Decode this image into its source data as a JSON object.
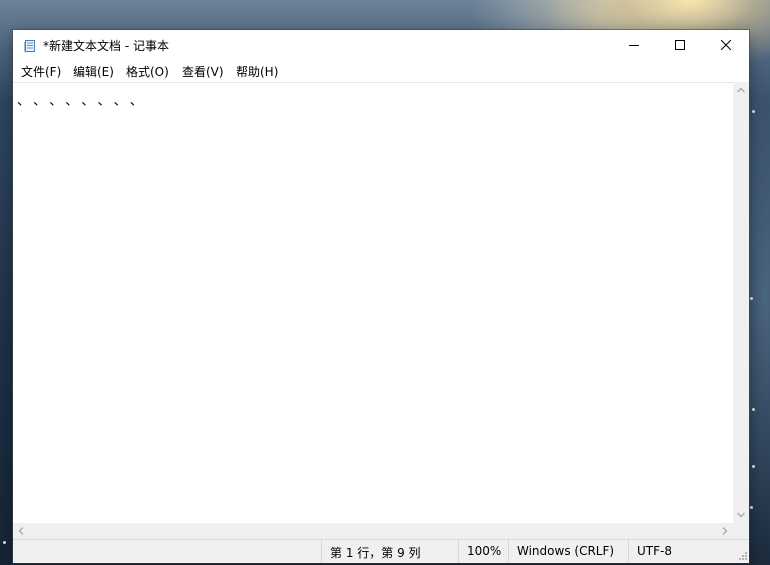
{
  "window": {
    "title": "*新建文本文档 - 记事本",
    "app_icon": "notepad-icon"
  },
  "titlebar_buttons": {
    "minimize_icon": "minimize-icon",
    "maximize_icon": "maximize-icon",
    "close_icon": "close-icon"
  },
  "menu": {
    "items": [
      {
        "label": "文件(F)"
      },
      {
        "label": "编辑(E)"
      },
      {
        "label": "格式(O)"
      },
      {
        "label": "查看(V)"
      },
      {
        "label": "帮助(H)"
      }
    ]
  },
  "editor": {
    "content": "、、、、、、、、"
  },
  "scrollbars": {
    "up_icon": "chevron-up-icon",
    "down_icon": "chevron-down-icon",
    "left_icon": "chevron-left-icon",
    "right_icon": "chevron-right-icon"
  },
  "status": {
    "position": "第 1 行，第 9 列",
    "zoom": "100%",
    "line_ending": "Windows (CRLF)",
    "encoding": "UTF-8"
  },
  "colors": {
    "window_bg": "#ffffff",
    "status_bg": "#f0f0f0",
    "text": "#000000"
  }
}
